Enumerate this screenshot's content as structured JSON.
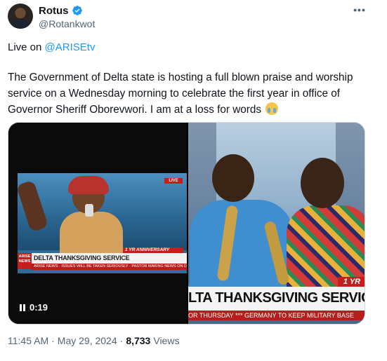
{
  "author": {
    "name": "Rotus",
    "handle": "@Rotankwot",
    "verified_color": "#1d9bf0"
  },
  "tweet": {
    "line1_prefix": "Live on ",
    "mention": "@ARISEtv",
    "body": "The Government of Delta state is hosting a full blown praise and worship service on a Wednesday morning to celebrate the first year in office of Governor Sheriff Oborevwori. I am at a loss for words",
    "emoji": "loudly-crying-face"
  },
  "media": {
    "left_video": {
      "duration": "0:19",
      "tv_live_tag": "LIVE",
      "tv_anniversary": "1 YR ANNIVERSARY",
      "tv_logo": "ARISE NEWS",
      "tv_banner": "DELTA THANKSGIVING SERVICE",
      "tv_ticker": "ARISE NEWS · ISSUES WILL BE TAKEN SERIOUSLY · PASTOR MAKING NEWS ON DELTA"
    },
    "right_video": {
      "corner_tag": "1 YR",
      "banner": "LTA THANKSGIVING SERVICE",
      "ticker": "OR THURSDAY  ***  GERMANY TO KEEP MILITARY BASE"
    }
  },
  "meta": {
    "time": "11:45 AM",
    "separator": "·",
    "date": "May 29, 2024",
    "views_count": "8,733",
    "views_label": "Views"
  },
  "colors": {
    "text": "#0f1419",
    "secondary": "#536471",
    "link": "#1d9bf0",
    "news_red": "#c41e1e"
  }
}
